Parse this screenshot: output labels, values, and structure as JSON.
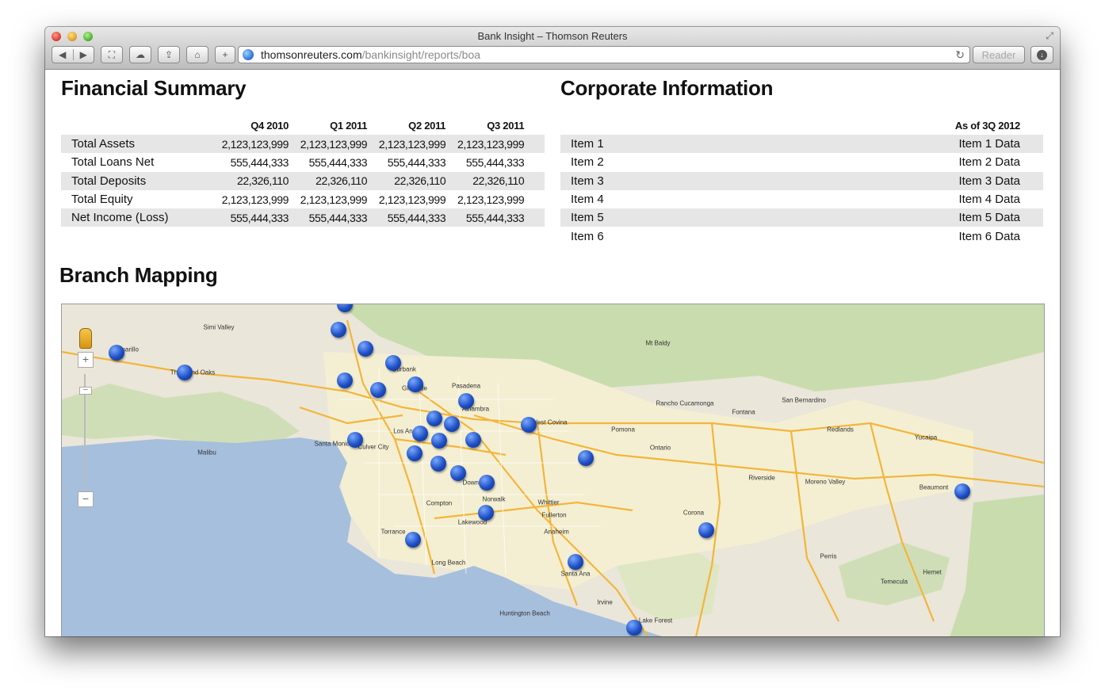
{
  "window": {
    "title": "Bank Insight – Thomson Reuters",
    "url_domain": "thomsonreuters.com",
    "url_path": "/bankinsight/reports/boa",
    "reader_label": "Reader"
  },
  "financial_summary": {
    "heading": "Financial Summary",
    "columns": [
      "Q4 2010",
      "Q1 2011",
      "Q2 2011",
      "Q3 2011"
    ],
    "rows": [
      {
        "label": "Total Assets",
        "values": [
          "2,123,123,999",
          "2,123,123,999",
          "2,123,123,999",
          "2,123,123,999"
        ]
      },
      {
        "label": "Total Loans Net",
        "values": [
          "555,444,333",
          "555,444,333",
          "555,444,333",
          "555,444,333"
        ]
      },
      {
        "label": "Total Deposits",
        "values": [
          "22,326,110",
          "22,326,110",
          "22,326,110",
          "22,326,110"
        ]
      },
      {
        "label": "Total Equity",
        "values": [
          "2,123,123,999",
          "2,123,123,999",
          "2,123,123,999",
          "2,123,123,999"
        ]
      },
      {
        "label": "Net Income (Loss)",
        "values": [
          "555,444,333",
          "555,444,333",
          "555,444,333",
          "555,444,333"
        ]
      }
    ]
  },
  "corporate_information": {
    "heading": "Corporate Information",
    "column": "As of 3Q 2012",
    "rows": [
      {
        "label": "Item 1",
        "value": "Item 1 Data"
      },
      {
        "label": "Item 2",
        "value": "Item 2 Data"
      },
      {
        "label": "Item 3",
        "value": "Item 3 Data"
      },
      {
        "label": "Item 4",
        "value": "Item 4 Data"
      },
      {
        "label": "Item 5",
        "value": "Item 5 Data"
      },
      {
        "label": "Item 6",
        "value": "Item 6 Data"
      }
    ]
  },
  "branch_mapping": {
    "heading": "Branch Mapping",
    "place_labels": [
      "Simi Valley",
      "Thousand Oaks",
      "Camarillo",
      "Santa Monica",
      "Culver City",
      "Los Angeles",
      "Burbank",
      "Glendale",
      "Pasadena",
      "Alhambra",
      "West Covina",
      "Pomona",
      "Ontario",
      "Rancho Cucamonga",
      "Fontana",
      "San Bernardino",
      "Redlands",
      "Riverside",
      "Corona",
      "Moreno Valley",
      "Perris",
      "Hemet",
      "Norwalk",
      "Downey",
      "Lakewood",
      "Long Beach",
      "Torrance",
      "Anaheim",
      "Santa Ana",
      "Irvine",
      "Fullerton",
      "Compton",
      "Malibu",
      "Yucaipa",
      "Beaumont",
      "Whittier",
      "Lake Forest",
      "Huntington Beach",
      "Mt Baldy",
      "Temecula"
    ]
  },
  "colors": {
    "map_water": "#a6bfdd",
    "map_land": "#eae6d9",
    "map_parks": "#c9dcae",
    "marker": "#1e4fc4",
    "table_shade": "#e6e6e6"
  }
}
